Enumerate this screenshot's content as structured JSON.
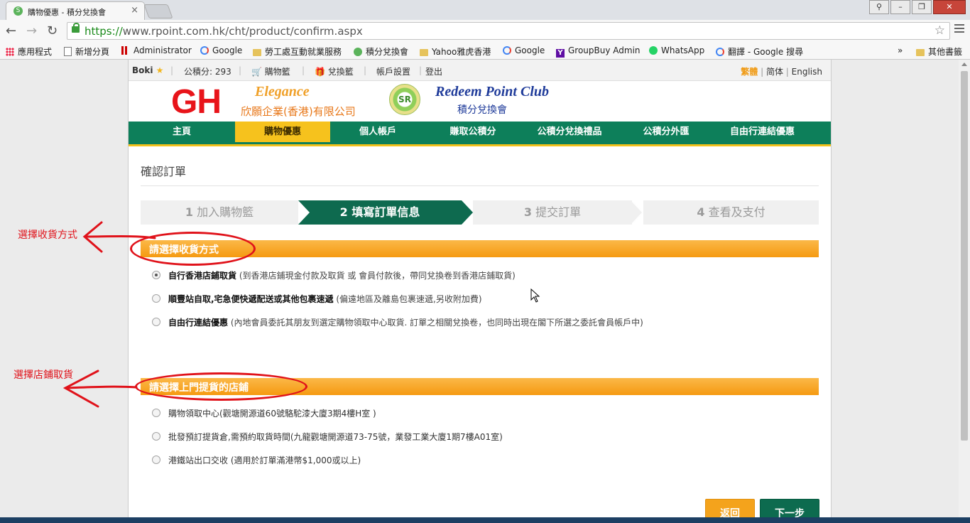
{
  "browser": {
    "tab_title": "購物優惠 - 積分兌換會",
    "url_scheme": "https://",
    "url_rest": "www.rpoint.com.hk/cht/product/confirm.aspx",
    "bookmarks": [
      {
        "label": "應用程式",
        "icon": "apps-icon"
      },
      {
        "label": "新增分頁",
        "icon": "page-icon"
      },
      {
        "label": "Administrator",
        "icon": "bars-icon"
      },
      {
        "label": "Google",
        "icon": "google-icon"
      },
      {
        "label": "勞工處互動就業服務",
        "icon": "folder-icon"
      },
      {
        "label": "積分兌換會",
        "icon": "sr-icon"
      },
      {
        "label": "Yahoo雅虎香港",
        "icon": "folder-icon"
      },
      {
        "label": "Google",
        "icon": "google-icon"
      },
      {
        "label": "GroupBuy Admin",
        "icon": "yahoo-icon"
      },
      {
        "label": "WhatsApp",
        "icon": "whatsapp-icon"
      },
      {
        "label": "翻譯 - Google 搜尋",
        "icon": "google-icon"
      }
    ],
    "bookmarks_more": "»",
    "other_bookmarks": "其他書籤"
  },
  "member_bar": {
    "user": "Boki",
    "points": "公積分: 293",
    "cart": "購物籃",
    "redeem_cart": "兌換籃",
    "account": "帳戶設置",
    "logout": "登出",
    "lang_trad": "繁體",
    "lang_simp": "简体",
    "lang_en": "English"
  },
  "brand": {
    "gh": "GH",
    "elegance": "Elegance",
    "company": "欣願企業(香港)有限公司",
    "seal": "SR",
    "club": "Redeem Point Club",
    "club_sub": "積分兌換會"
  },
  "nav": [
    {
      "label": "主頁",
      "active": false
    },
    {
      "label": "購物優惠",
      "active": true
    },
    {
      "label": "個人帳戶",
      "active": false
    },
    {
      "label": "賺取公積分",
      "active": false
    },
    {
      "label": "公積分兌換禮品",
      "active": false
    },
    {
      "label": "公積分外匯",
      "active": false
    },
    {
      "label": "自由行連結優惠",
      "active": false
    }
  ],
  "page_title": "確認訂單",
  "steps": [
    {
      "num": "1",
      "label": "加入購物籃"
    },
    {
      "num": "2",
      "label": "填寫訂單信息"
    },
    {
      "num": "3",
      "label": "提交訂單"
    },
    {
      "num": "4",
      "label": "查看及支付"
    }
  ],
  "delivery_section": {
    "heading": "請選擇收貨方式",
    "options": [
      {
        "title": "自行香港店鋪取貨",
        "note": " (到香港店鋪現金付款及取貨 或 會員付款後，帶同兌換卷到香港店鋪取貨)",
        "checked": true
      },
      {
        "title": "順豐站自取,宅急便快遞配送或其他包裹速遞",
        "note": " (偏遠地區及離島包裹速遞,另收附加費)",
        "checked": false
      },
      {
        "title": "自由行連結優惠",
        "note": " (內地會員委託其朋友到選定購物領取中心取貨. 訂單之相關兌換卷，也同時出現在閣下所選之委託會員帳戶中)",
        "checked": false
      }
    ]
  },
  "store_section": {
    "heading": "請選擇上門提貨的店鋪",
    "options": [
      {
        "text": "購物領取中心(觀塘開源道60號駱駝漆大廈3期4樓H室 )",
        "checked": false
      },
      {
        "text": "批發預訂提貨倉,需預約取貨時間(九龍觀塘開源道73-75號，業發工業大廈1期7樓A01室)",
        "checked": false
      },
      {
        "text": "港鐵站出口交收 (適用於訂單滿港幣$1,000或以上)",
        "checked": false
      }
    ]
  },
  "buttons": {
    "back": "返回",
    "next": "下一步"
  },
  "annotations": {
    "delivery": "選擇收貨方式",
    "store": "選擇店鋪取貨"
  },
  "colors": {
    "nav_green": "#0d7f5a",
    "nav_active": "#f6c21d",
    "section_orange": "#f59a11",
    "annotation_red": "#e0121a"
  }
}
